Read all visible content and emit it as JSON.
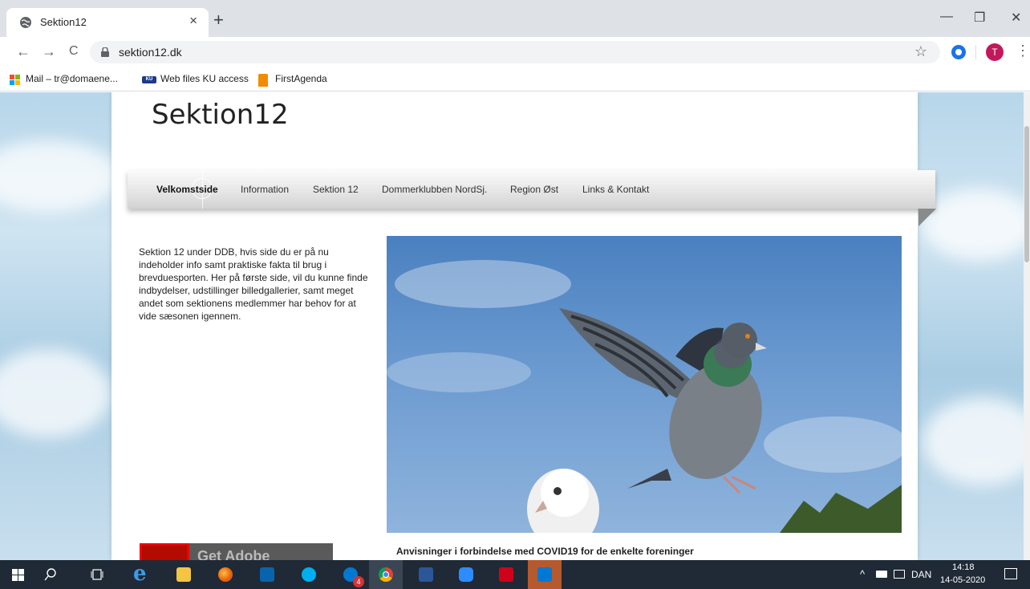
{
  "browser": {
    "tab_title": "Sektion12",
    "tab_close": "×",
    "new_tab": "+",
    "win_minimize": "—",
    "win_restore": "❐",
    "win_close": "✕",
    "nav_back": "←",
    "nav_forward": "→",
    "nav_reload": "C",
    "url": "sektion12.dk",
    "star": "☆",
    "profile_initial": "T",
    "menu": "⋮",
    "bookmarks": [
      {
        "label": "Mail – tr@domaene...",
        "icon": "microsoft-icon"
      },
      {
        "label": "Web files KU access",
        "icon": "ku-icon"
      },
      {
        "label": "FirstAgenda",
        "icon": "firstagenda-icon"
      }
    ]
  },
  "site": {
    "title": "Sektion12",
    "nav": [
      "Velkomstside",
      "Information",
      "Sektion 12",
      "Dommerklubben NordSj.",
      "Region Øst",
      "Links & Kontakt"
    ],
    "active_nav": "Velkomstside",
    "intro": "Sektion 12 under DDB, hvis side du er på nu indeholder info samt praktiske fakta til brug i brevduesporten. Her på første side, vil du kunne finde indbydelser, udstillinger billedgallerier, samt meget andet som sektionens medlemmer har behov for at vide sæsonen igennem.",
    "adobe_text": "Get Adobe",
    "covid_heading": "Anvisninger i forbindelse med COVID19 for de enkelte foreninger"
  },
  "taskbar": {
    "language": "DAN",
    "time": "14:18",
    "date": "14-05-2020",
    "skype_badge": "4",
    "chevron": "^"
  },
  "colors": {
    "accent_profile": "#c2185b",
    "taskbar_bg": "#1f2a36",
    "sky": "#4a80c0"
  }
}
